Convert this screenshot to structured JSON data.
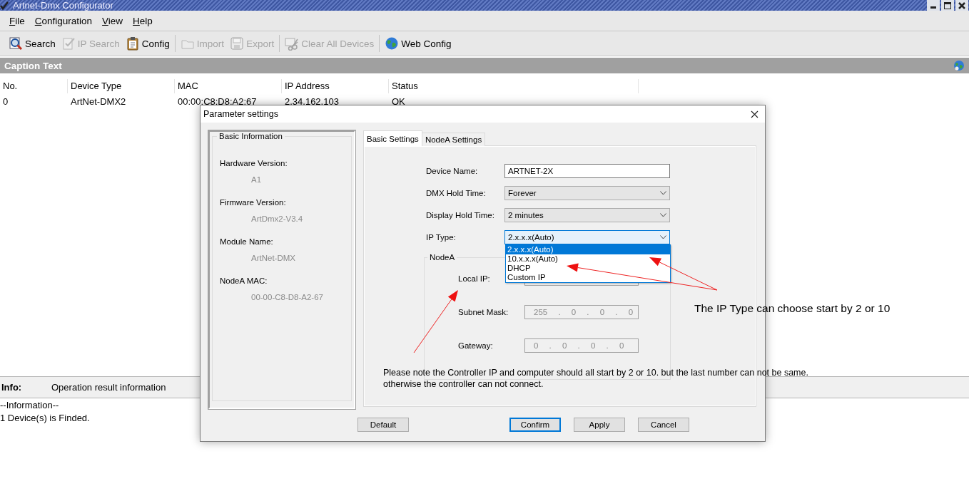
{
  "window": {
    "title": "Artnet-Dmx Configurator"
  },
  "menu": [
    "File",
    "Configuration",
    "View",
    "Help"
  ],
  "toolbar": [
    [
      {
        "kind": "search",
        "label": "Search",
        "disabled": false
      },
      {
        "kind": "ipsearch",
        "label": "IP Search",
        "disabled": true
      },
      {
        "kind": "config",
        "label": "Config",
        "disabled": false
      }
    ],
    [
      {
        "kind": "import",
        "label": "Import",
        "disabled": true
      },
      {
        "kind": "export",
        "label": "Export",
        "disabled": true
      }
    ],
    [
      {
        "kind": "clear",
        "label": "Clear All Devices",
        "disabled": true
      }
    ],
    [
      {
        "kind": "web",
        "label": "Web Config",
        "disabled": false
      }
    ]
  ],
  "caption": {
    "title": "Caption Text"
  },
  "table": {
    "columns": [
      "No.",
      "Device Type",
      "MAC",
      "IP Address",
      "Status"
    ],
    "rows": [
      [
        "0",
        "ArtNet-DMX2",
        "00:00:C8:D8:A2:67",
        "2.34.162.103",
        "OK"
      ]
    ]
  },
  "info": {
    "label": "Info:",
    "text": "Operation result information",
    "log": [
      "--Information--",
      "1 Device(s) is Finded."
    ]
  },
  "dialog": {
    "title": "Parameter settings",
    "basic_info": {
      "title": "Basic Information",
      "fields": [
        {
          "label": "Hardware Version:",
          "value": "A1"
        },
        {
          "label": "Firmware Version:",
          "value": "ArtDmx2-V3.4"
        },
        {
          "label": "Module Name:",
          "value": "ArtNet-DMX"
        },
        {
          "label": "NodeA MAC:",
          "value": "00-00-C8-D8-A2-67"
        }
      ]
    },
    "tabs": [
      {
        "label": "Basic Settings",
        "selected": true
      },
      {
        "label": "NodeA Settings",
        "selected": false
      }
    ],
    "form": [
      {
        "kind": "text",
        "label": "Device Name:",
        "value": "ARTNET-2X"
      },
      {
        "kind": "select",
        "label": "DMX Hold Time:",
        "value": "Forever",
        "expanded": false
      },
      {
        "kind": "select",
        "label": "Display Hold Time:",
        "value": "2 minutes",
        "expanded": false
      },
      {
        "kind": "select",
        "label": "IP Type:",
        "value": "2.x.x.x(Auto)",
        "expanded": true,
        "options": [
          {
            "label": "2.x.x.x(Auto)",
            "selected": true
          },
          {
            "label": "10.x.x.x(Auto)",
            "selected": false
          },
          {
            "label": "DHCP",
            "selected": false
          },
          {
            "label": "Custom IP",
            "selected": false
          }
        ]
      }
    ],
    "nodea": {
      "title": "NodeA",
      "fields": [
        {
          "label": "Local IP:"
        },
        {
          "label": "Subnet Mask:",
          "value": "255 . 0 . 0 . 0"
        },
        {
          "label": "Gateway:",
          "value": "0 . 0 . 0 . 0"
        }
      ]
    },
    "buttons": [
      {
        "label": "Default",
        "focused": false
      },
      {
        "label": "Confirm",
        "focused": true
      },
      {
        "label": "Apply",
        "focused": false
      },
      {
        "label": "Cancel",
        "focused": false
      }
    ]
  },
  "annotations": {
    "note": [
      "Please note the Controller IP and computer should all start by 2 or 10. but the last number can not be same.",
      "otherwise the controller can not connect."
    ],
    "callout": "The IP Type can choose start by 2 or 10"
  }
}
